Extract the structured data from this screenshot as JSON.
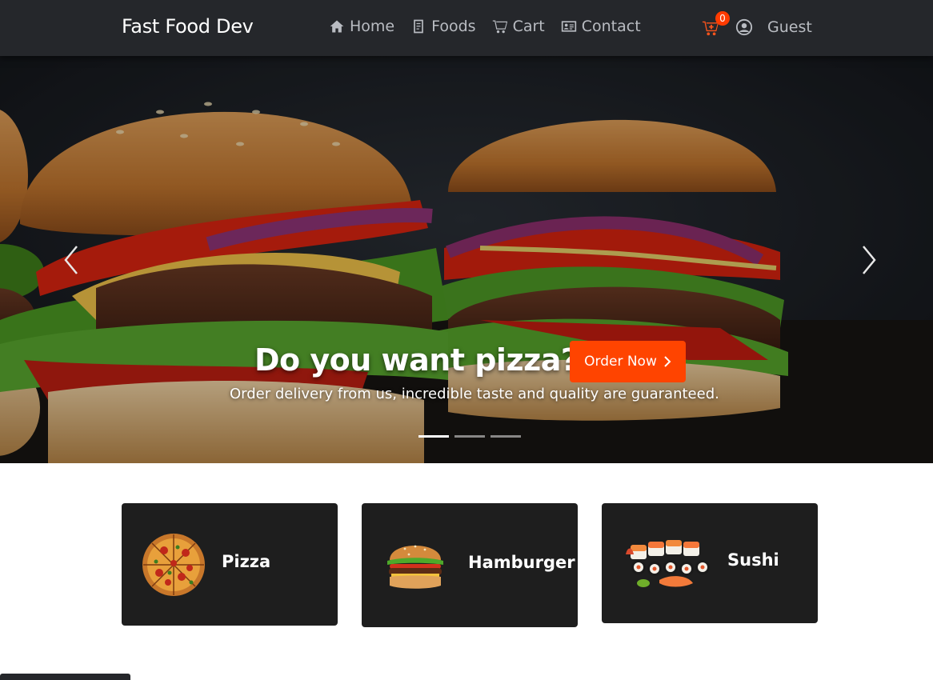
{
  "navbar": {
    "brand": "Fast Food Dev",
    "links": [
      {
        "label": "Home",
        "icon": "home-icon"
      },
      {
        "label": "Foods",
        "icon": "document-icon"
      },
      {
        "label": "Cart",
        "icon": "cart-icon"
      },
      {
        "label": "Contact",
        "icon": "contact-card-icon"
      }
    ],
    "cart_count": "0",
    "user_label": "Guest",
    "accent_color": "#fa541c"
  },
  "hero": {
    "title": "Do you want pizza?",
    "button_label": "Order Now",
    "subtitle": "Order delivery from us, incredible taste and quality are guaranteed.",
    "slides": 3,
    "active_slide": 1
  },
  "categories": [
    {
      "label": "Pizza",
      "icon": "pizza-icon"
    },
    {
      "label": "Hamburger",
      "icon": "hamburger-icon"
    },
    {
      "label": "Sushi",
      "icon": "sushi-icon"
    }
  ]
}
